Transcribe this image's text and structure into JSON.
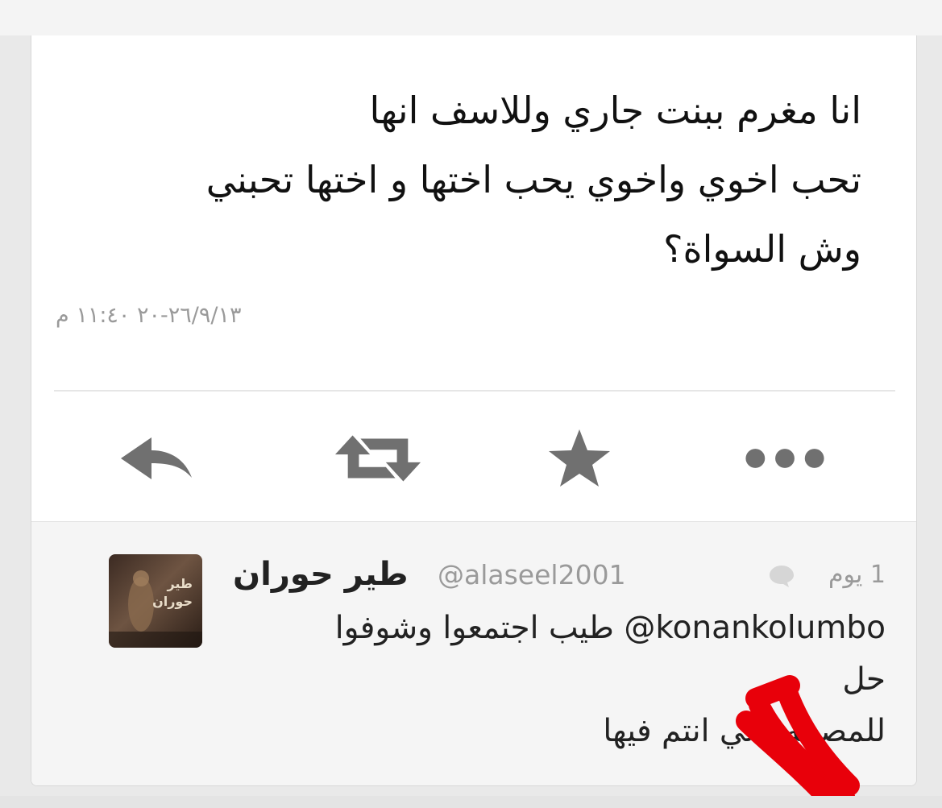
{
  "tweet": {
    "lines": [
      "انا مغرم ببنت جاري وللاسف انها",
      "تحب اخوي واخوي يحب اختها و اختها تحبني",
      "وش السواة؟"
    ],
    "timestamp": "٢٦/٩/١٣-٢٠ ١١:٤٠ م"
  },
  "actions": [
    {
      "name": "reply",
      "icon": "reply-arrow-icon"
    },
    {
      "name": "retweet",
      "icon": "retweet-icon"
    },
    {
      "name": "favorite",
      "icon": "star-icon"
    },
    {
      "name": "more",
      "icon": "more-dots-icon"
    }
  ],
  "reply": {
    "name": "طير حوران",
    "handle": "@alaseel2001",
    "time": "1 يوم",
    "mention": "@konankolumbo",
    "line1_text": "طيب اجتمعوا وشوفوا",
    "line2": "حل",
    "line3": "للمصيبه اللي انتم فيها",
    "avatar_text": "طير حوران"
  },
  "colors": {
    "icon_gray": "#707070",
    "annotation_red": "#e8000a"
  }
}
